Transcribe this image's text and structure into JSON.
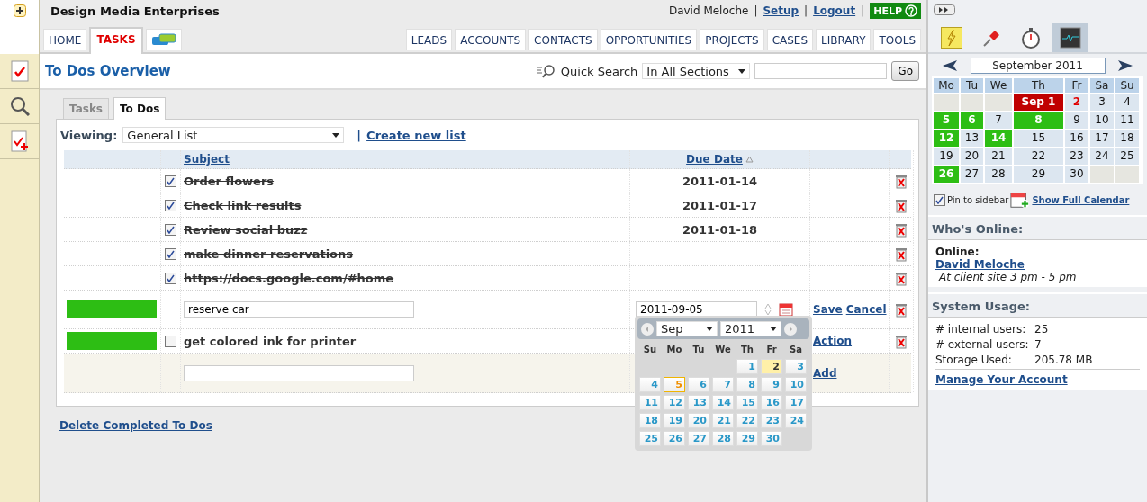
{
  "header": {
    "company": "Design Media Enterprises",
    "user": "David Meloche",
    "links": [
      "Setup",
      "Logout"
    ],
    "separator": "|",
    "help": "HELP"
  },
  "nav_left": [
    {
      "kind": "text",
      "label": "HOME",
      "selected": false
    },
    {
      "kind": "text",
      "label": "TASKS",
      "selected": true
    },
    {
      "kind": "icon",
      "selected": false
    }
  ],
  "nav_right": [
    {
      "label": "LEADS",
      "selected": false
    },
    {
      "label": "ACCOUNTS",
      "selected": false
    },
    {
      "label": "CONTACTS",
      "selected": false
    },
    {
      "label": "OPPORTUNITIES",
      "selected": false
    },
    {
      "label": "PROJECTS",
      "selected": false
    },
    {
      "label": "CASES",
      "selected": false
    },
    {
      "label": "LIBRARY",
      "selected": false
    },
    {
      "label": "TOOLS",
      "selected": false
    }
  ],
  "page_title": "To Dos Overview",
  "quick_search": {
    "label": "Quick Search",
    "scope": "In All Sections",
    "button": "Go"
  },
  "sub_tabs": [
    {
      "label": "Tasks",
      "selected": false
    },
    {
      "label": "To Dos",
      "selected": true
    }
  ],
  "viewing": {
    "label": "Viewing:",
    "value": "General List",
    "separator": "|",
    "link": "Create new list"
  },
  "table": {
    "columns": [
      "Subject",
      "Due Date"
    ],
    "rows": [
      {
        "kind": "item",
        "checked": true,
        "subject": "Order flowers",
        "due": "2011-01-14"
      },
      {
        "kind": "item",
        "checked": true,
        "subject": "Check link results",
        "due": "2011-01-17"
      },
      {
        "kind": "item",
        "checked": true,
        "subject": "Review social buzz",
        "due": "2011-01-18"
      },
      {
        "kind": "item",
        "checked": true,
        "subject": "make dinner reservations"
      },
      {
        "kind": "item",
        "checked": true,
        "subject": "https://docs.google.com/#home"
      },
      {
        "kind": "edit",
        "color": "#2dbe14",
        "subject": "reserve car",
        "due": "2011-09-05",
        "actions": [
          "Save",
          "Cancel"
        ]
      },
      {
        "kind": "item",
        "color": "#2dbe14",
        "checked": false,
        "subject": "get colored ink for printer",
        "actions": [
          "Action"
        ]
      },
      {
        "kind": "new",
        "actions": [
          "Add"
        ]
      }
    ]
  },
  "datepicker": {
    "month": "Sep",
    "year": "2011",
    "weekdays": [
      "Su",
      "Mo",
      "Tu",
      "We",
      "Th",
      "Fr",
      "Sa"
    ],
    "weeks": [
      [
        {
          "kind": "blank"
        },
        {
          "kind": "blank"
        },
        {
          "kind": "blank"
        },
        {
          "kind": "blank"
        },
        {
          "kind": "day",
          "label": "1",
          "today": false,
          "selected": false
        },
        {
          "kind": "day",
          "label": "2",
          "today": true,
          "selected": false
        },
        {
          "kind": "day",
          "label": "3",
          "today": false,
          "selected": false
        }
      ],
      [
        {
          "kind": "day",
          "label": "4",
          "today": false,
          "selected": false
        },
        {
          "kind": "day",
          "label": "5",
          "today": false,
          "selected": true
        },
        {
          "kind": "day",
          "label": "6",
          "today": false,
          "selected": false
        },
        {
          "kind": "day",
          "label": "7",
          "today": false,
          "selected": false
        },
        {
          "kind": "day",
          "label": "8",
          "today": false,
          "selected": false
        },
        {
          "kind": "day",
          "label": "9",
          "today": false,
          "selected": false
        },
        {
          "kind": "day",
          "label": "10",
          "today": false,
          "selected": false
        }
      ],
      [
        {
          "kind": "day",
          "label": "11",
          "today": false,
          "selected": false
        },
        {
          "kind": "day",
          "label": "12",
          "today": false,
          "selected": false
        },
        {
          "kind": "day",
          "label": "13",
          "today": false,
          "selected": false
        },
        {
          "kind": "day",
          "label": "14",
          "today": false,
          "selected": false
        },
        {
          "kind": "day",
          "label": "15",
          "today": false,
          "selected": false
        },
        {
          "kind": "day",
          "label": "16",
          "today": false,
          "selected": false
        },
        {
          "kind": "day",
          "label": "17",
          "today": false,
          "selected": false
        }
      ],
      [
        {
          "kind": "day",
          "label": "18",
          "today": false,
          "selected": false
        },
        {
          "kind": "day",
          "label": "19",
          "today": false,
          "selected": false
        },
        {
          "kind": "day",
          "label": "20",
          "today": false,
          "selected": false
        },
        {
          "kind": "day",
          "label": "21",
          "today": false,
          "selected": false
        },
        {
          "kind": "day",
          "label": "22",
          "today": false,
          "selected": false
        },
        {
          "kind": "day",
          "label": "23",
          "today": false,
          "selected": false
        },
        {
          "kind": "day",
          "label": "24",
          "today": false,
          "selected": false
        }
      ],
      [
        {
          "kind": "day",
          "label": "25",
          "today": false,
          "selected": false
        },
        {
          "kind": "day",
          "label": "26",
          "today": false,
          "selected": false
        },
        {
          "kind": "day",
          "label": "27",
          "today": false,
          "selected": false
        },
        {
          "kind": "day",
          "label": "28",
          "today": false,
          "selected": false
        },
        {
          "kind": "day",
          "label": "29",
          "today": false,
          "selected": false
        },
        {
          "kind": "day",
          "label": "30",
          "today": false,
          "selected": false
        },
        {
          "kind": "blank"
        }
      ]
    ]
  },
  "delete_completed": "Delete Completed To Dos",
  "sidebar": {
    "tools": [
      {
        "selected": false
      },
      {
        "selected": false
      },
      {
        "selected": false
      },
      {
        "selected": true
      }
    ],
    "calendar": {
      "month": "September 2011",
      "weekdays": [
        "Mo",
        "Tu",
        "We",
        "Th",
        "Fr",
        "Sa",
        "Su"
      ],
      "weeks": [
        [
          {
            "kind": "blank"
          },
          {
            "kind": "blank"
          },
          {
            "kind": "blank"
          },
          {
            "kind": "event",
            "label": "Sep 1",
            "color": "#c00000"
          },
          {
            "kind": "day",
            "label": "2",
            "today": true
          },
          {
            "kind": "day",
            "label": "3",
            "today": false
          },
          {
            "kind": "day",
            "label": "4",
            "today": false
          }
        ],
        [
          {
            "kind": "event",
            "label": "5",
            "color": "#2dbe14"
          },
          {
            "kind": "event",
            "label": "6",
            "color": "#2dbe14"
          },
          {
            "kind": "day",
            "label": "7",
            "today": false
          },
          {
            "kind": "event",
            "label": "8",
            "color": "#2dbe14"
          },
          {
            "kind": "day",
            "label": "9",
            "today": false
          },
          {
            "kind": "day",
            "label": "10",
            "today": false
          },
          {
            "kind": "day",
            "label": "11",
            "today": false
          }
        ],
        [
          {
            "kind": "event",
            "label": "12",
            "color": "#2dbe14"
          },
          {
            "kind": "day",
            "label": "13",
            "today": false
          },
          {
            "kind": "event",
            "label": "14",
            "color": "#2dbe14"
          },
          {
            "kind": "day",
            "label": "15",
            "today": false
          },
          {
            "kind": "day",
            "label": "16",
            "today": false
          },
          {
            "kind": "day",
            "label": "17",
            "today": false
          },
          {
            "kind": "day",
            "label": "18",
            "today": false
          }
        ],
        [
          {
            "kind": "day",
            "label": "19",
            "today": false
          },
          {
            "kind": "day",
            "label": "20",
            "today": false
          },
          {
            "kind": "day",
            "label": "21",
            "today": false
          },
          {
            "kind": "day",
            "label": "22",
            "today": false
          },
          {
            "kind": "day",
            "label": "23",
            "today": false
          },
          {
            "kind": "day",
            "label": "24",
            "today": false
          },
          {
            "kind": "day",
            "label": "25",
            "today": false
          }
        ],
        [
          {
            "kind": "event",
            "label": "26",
            "color": "#2dbe14"
          },
          {
            "kind": "day",
            "label": "27",
            "today": false
          },
          {
            "kind": "day",
            "label": "28",
            "today": false
          },
          {
            "kind": "day",
            "label": "29",
            "today": false
          },
          {
            "kind": "day",
            "label": "30",
            "today": false
          },
          {
            "kind": "blank"
          },
          {
            "kind": "blank"
          }
        ]
      ],
      "pin": {
        "label": "Pin to sidebar",
        "checked": true
      },
      "link": "Show Full Calendar"
    },
    "who_online": {
      "title": "Who's Online:",
      "heading": "Online:",
      "user": "David Meloche",
      "status": "At client site 3 pm - 5 pm"
    },
    "system_usage": {
      "title": "System Usage:",
      "stats": [
        {
          "label": "# internal users:",
          "value": "25"
        },
        {
          "label": "# external users:",
          "value": "7"
        },
        {
          "label": "Storage Used:",
          "value": "205.78 MB"
        }
      ],
      "link": "Manage Your Account"
    }
  }
}
